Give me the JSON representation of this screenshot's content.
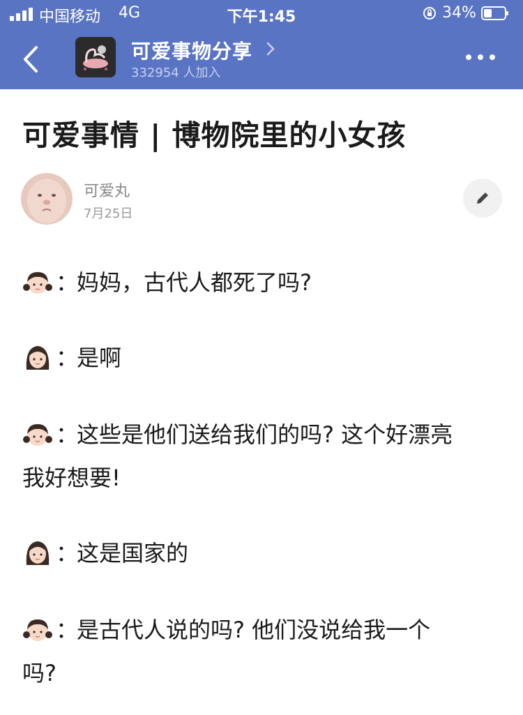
{
  "status_bar": {
    "carrier": "中国移动",
    "network": "4G",
    "time": "下午1:45",
    "battery_percent": "34%"
  },
  "nav": {
    "group_name": "可爱事物分享",
    "member_count": "332954 人加入"
  },
  "article": {
    "title": "可爱事情 | 博物院里的小女孩",
    "author": "可爱丸",
    "date": "7月25日",
    "lines": [
      {
        "speaker": "girl",
        "colon": "：",
        "text": "妈妈，古代人都死了吗?"
      },
      {
        "speaker": "mother",
        "colon": "：",
        "text": "是啊"
      },
      {
        "speaker": "girl",
        "colon": "：",
        "text": "这些是他们送给我们的吗?  这个好漂亮"
      },
      {
        "speaker": "none",
        "colon": "",
        "text": "我好想要!"
      },
      {
        "speaker": "mother",
        "colon": "：",
        "text": "这是国家的"
      },
      {
        "speaker": "girl",
        "colon": "：",
        "text": "是古代人说的吗?  他们没说给我一个"
      },
      {
        "speaker": "none",
        "colon": "",
        "text": "吗?"
      }
    ]
  },
  "colors": {
    "header_bg": "#5a74c4",
    "text": "#1a1a1a",
    "muted": "#888888"
  },
  "icons": [
    "signal-icon",
    "rotation-lock-icon",
    "battery-icon",
    "back-icon",
    "chevron-right-icon",
    "more-icon",
    "edit-icon",
    "girl-emoji-icon",
    "woman-emoji-icon"
  ]
}
